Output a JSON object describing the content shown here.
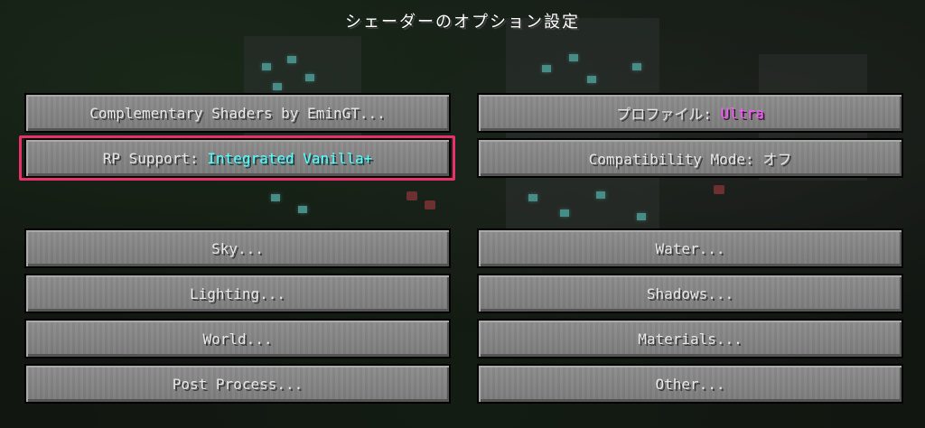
{
  "screen": {
    "title": "シェーダーのオプション設定"
  },
  "buttons": {
    "shader_pack": {
      "label": "Complementary Shaders by EminGT..."
    },
    "profile": {
      "label": "プロファイル: ",
      "value": "Ultra",
      "value_color": "#ff55ff"
    },
    "rp_support": {
      "label": "RP Support: ",
      "value": "Integrated Vanilla+",
      "value_color": "#55ffff",
      "highlighted": true,
      "highlight_color": "#e8306a"
    },
    "compatibility_mode": {
      "label": "Compatibility Mode: オフ"
    },
    "sky": {
      "label": "Sky..."
    },
    "water": {
      "label": "Water..."
    },
    "lighting": {
      "label": "Lighting..."
    },
    "shadows": {
      "label": "Shadows..."
    },
    "world": {
      "label": "World..."
    },
    "materials": {
      "label": "Materials..."
    },
    "post_process": {
      "label": "Post Process..."
    },
    "other": {
      "label": "Other..."
    }
  }
}
